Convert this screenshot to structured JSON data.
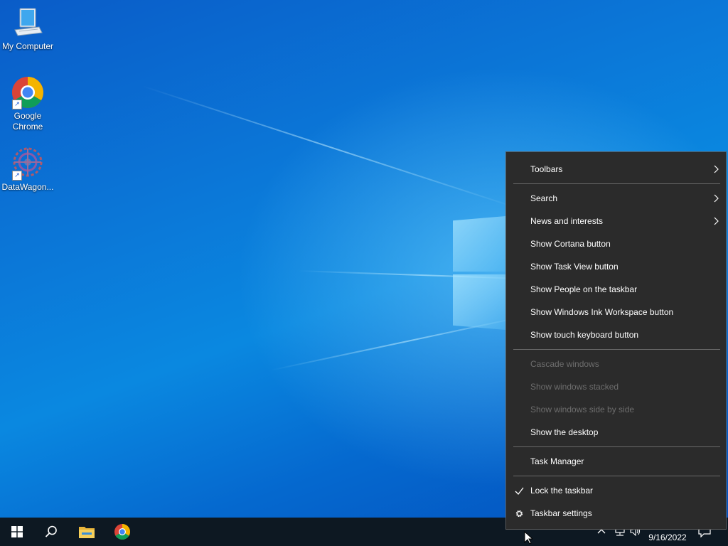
{
  "desktop": {
    "icons": [
      {
        "label": "My Computer",
        "icon": "computer-icon"
      },
      {
        "label": "Google Chrome",
        "icon": "chrome-icon"
      },
      {
        "label": "DataWagon...",
        "icon": "datawagon-icon"
      }
    ]
  },
  "context_menu": {
    "items": [
      {
        "label": "Toolbars",
        "submenu": true
      },
      {
        "label": "Search",
        "submenu": true
      },
      {
        "label": "News and interests",
        "submenu": true
      },
      {
        "label": "Show Cortana button"
      },
      {
        "label": "Show Task View button"
      },
      {
        "label": "Show People on the taskbar"
      },
      {
        "label": "Show Windows Ink Workspace button"
      },
      {
        "label": "Show touch keyboard button"
      },
      {
        "label": "Cascade windows",
        "disabled": true
      },
      {
        "label": "Show windows stacked",
        "disabled": true
      },
      {
        "label": "Show windows side by side",
        "disabled": true
      },
      {
        "label": "Show the desktop"
      },
      {
        "label": "Task Manager"
      },
      {
        "label": "Lock the taskbar",
        "checked": true
      },
      {
        "label": "Taskbar settings",
        "icon": "gear-icon"
      }
    ]
  },
  "taskbar": {
    "start_icon": "windows-logo-icon",
    "search_icon": "search-icon",
    "pinned": [
      "file-explorer-icon",
      "chrome-icon"
    ],
    "tray": {
      "date": "9/16/2022",
      "icons": [
        "chevron-up-icon",
        "network-icon",
        "volume-icon",
        "notification-icon"
      ]
    }
  },
  "colors": {
    "menu_bg": "#2b2b2b",
    "taskbar_bg": "#0d1822",
    "disabled_text": "#6d6d6d",
    "desktop_blue": "#0a78d8"
  }
}
